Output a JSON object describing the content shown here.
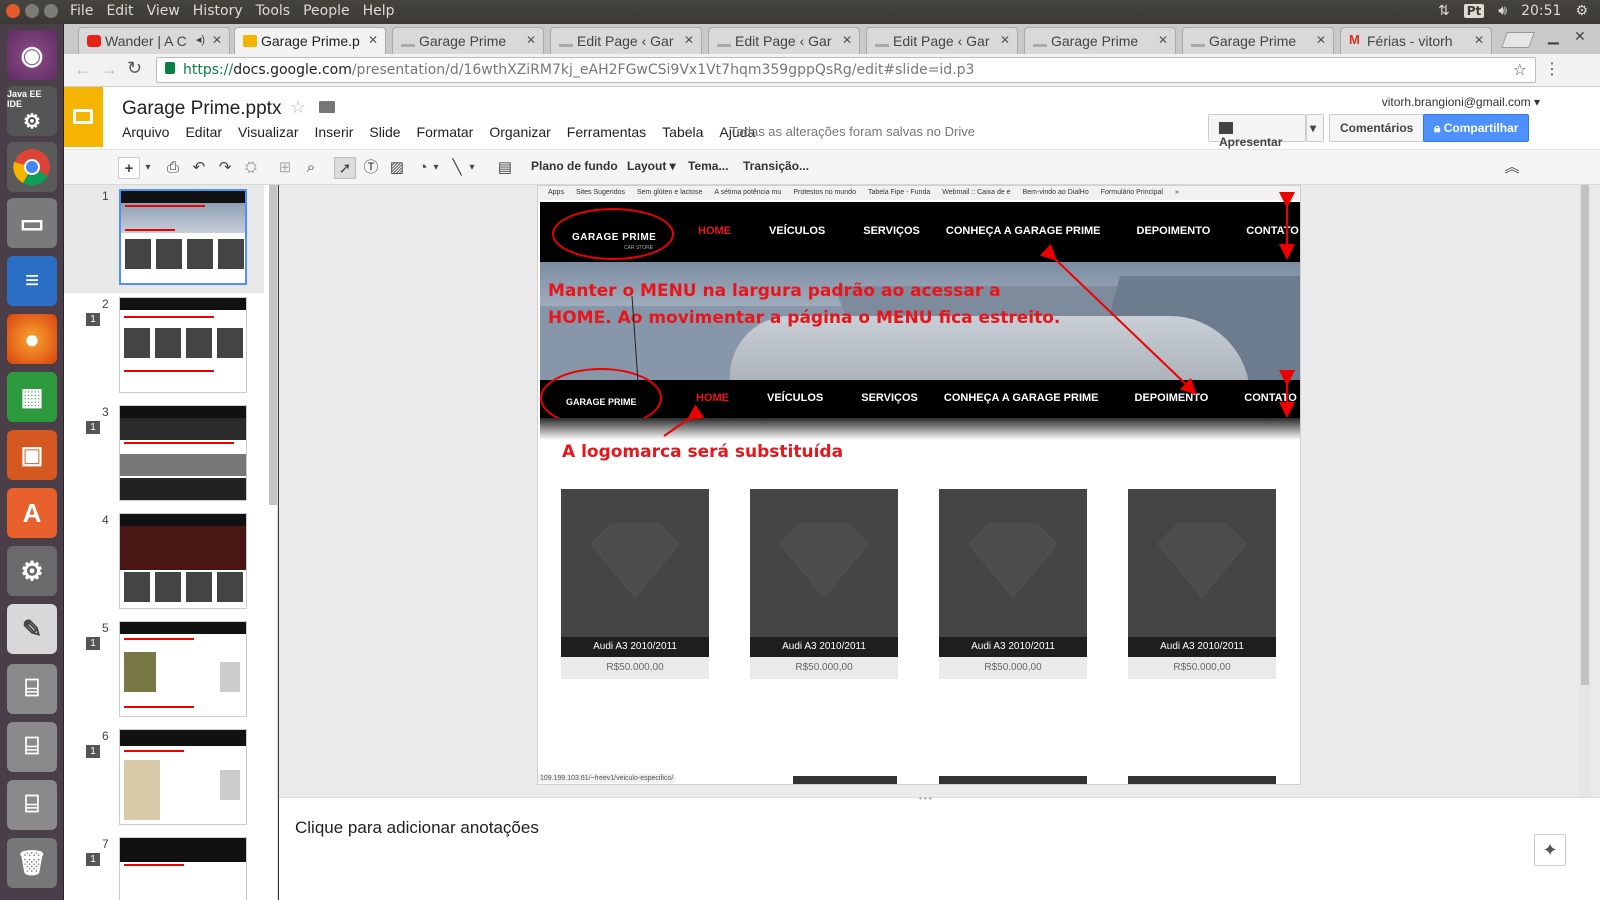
{
  "system": {
    "menu": [
      "File",
      "Edit",
      "View",
      "History",
      "Tools",
      "People",
      "Help"
    ],
    "keyboard": "Pt",
    "clock": "20:51"
  },
  "launcher": {
    "items": [
      "ubuntu-dash",
      "java-ee-ide",
      "chrome",
      "files",
      "writer",
      "firefox",
      "calc",
      "impress",
      "software-center",
      "system-settings",
      "text-editor",
      "drive-1",
      "drive-2",
      "drive-3",
      "trash"
    ],
    "java_label": "Java EE IDE"
  },
  "tabs": [
    {
      "title": "Wander | A C",
      "icon": "youtube-icon",
      "color": "#e62117"
    },
    {
      "title": "Garage Prime.p",
      "icon": "slides-icon",
      "color": "#f4b400"
    },
    {
      "title": "Garage Prime",
      "icon": "car-icon",
      "color": "#aaaaaa"
    },
    {
      "title": "Edit Page ‹ Gar",
      "icon": "car-icon",
      "color": "#aaaaaa"
    },
    {
      "title": "Edit Page ‹ Gar",
      "icon": "car-icon",
      "color": "#aaaaaa"
    },
    {
      "title": "Edit Page ‹ Gar",
      "icon": "car-icon",
      "color": "#aaaaaa"
    },
    {
      "title": "Garage Prime",
      "icon": "car-icon",
      "color": "#aaaaaa"
    },
    {
      "title": "Garage Prime",
      "icon": "car-icon",
      "color": "#aaaaaa"
    },
    {
      "title": "Férias - vitorh",
      "icon": "gmail-icon",
      "color": "#d93025"
    }
  ],
  "url": {
    "scheme": "https://",
    "host": "docs.google.com",
    "path": "/presentation/d/16wthXZiRM7kj_eAH2FGwCSi9Vx1Vt7hqm359gppQsRg/edit#slide=id.p3"
  },
  "app": {
    "title": "Garage Prime.pptx",
    "menu": [
      "Arquivo",
      "Editar",
      "Visualizar",
      "Inserir",
      "Slide",
      "Formatar",
      "Organizar",
      "Ferramentas",
      "Tabela",
      "Ajuda"
    ],
    "save_status": "Todas as alterações foram salvas no Drive",
    "account": "vitorh.brangioni@gmail.com",
    "present": "Apresentar",
    "comments": "Comentários",
    "share": "Compartilhar",
    "accent": "#4d90fe"
  },
  "toolbar": {
    "background": "Plano de fundo",
    "layout": "Layout",
    "theme": "Tema...",
    "transition": "Transição..."
  },
  "filmstrip": {
    "slides": [
      {
        "num": "1",
        "badge": ""
      },
      {
        "num": "2",
        "badge": "1"
      },
      {
        "num": "3",
        "badge": "1"
      },
      {
        "num": "4",
        "badge": ""
      },
      {
        "num": "5",
        "badge": "1"
      },
      {
        "num": "6",
        "badge": "1"
      },
      {
        "num": "7",
        "badge": "1"
      }
    ]
  },
  "slide": {
    "bookmarks": [
      "Apps",
      "Sites Sugeridos",
      "Sem glúten e lactose",
      "A sétima potência mu",
      "Protestos no mundo",
      "Tabela Fipe - Funda",
      "Webmail :: Caixa de e",
      "Bem-vindo ao DialHo",
      "Formulário Principal",
      "»"
    ],
    "logo_text": "GARAGE PRIME",
    "logo_sub": "CAR STORE",
    "nav": [
      "HOME",
      "VEÍCULOS",
      "SERVIÇOS",
      "CONHEÇA A GARAGE PRIME",
      "DEPOIMENTO",
      "CONTATO"
    ],
    "annotation_menu_line1": "Manter o MENU na largura padrão ao acessar a",
    "annotation_menu_line2": "HOME. Ao movimentar a página o MENU fica estreito.",
    "annotation_logo": "A logomarca será substituída",
    "cards": [
      {
        "name": "Audi A3 2010/2011",
        "price": "R$50.000,00"
      },
      {
        "name": "Audi A3 2010/2011",
        "price": "R$50.000,00"
      },
      {
        "name": "Audi A3 2010/2011",
        "price": "R$50.000,00"
      },
      {
        "name": "Audi A3 2010/2011",
        "price": "R$50.000,00"
      }
    ],
    "status_url": "109.199.103.61/~freev1/veiculo-especifico/",
    "annotation_color": "#e8151b"
  },
  "notes": {
    "placeholder": "Clique para adicionar anotações"
  }
}
